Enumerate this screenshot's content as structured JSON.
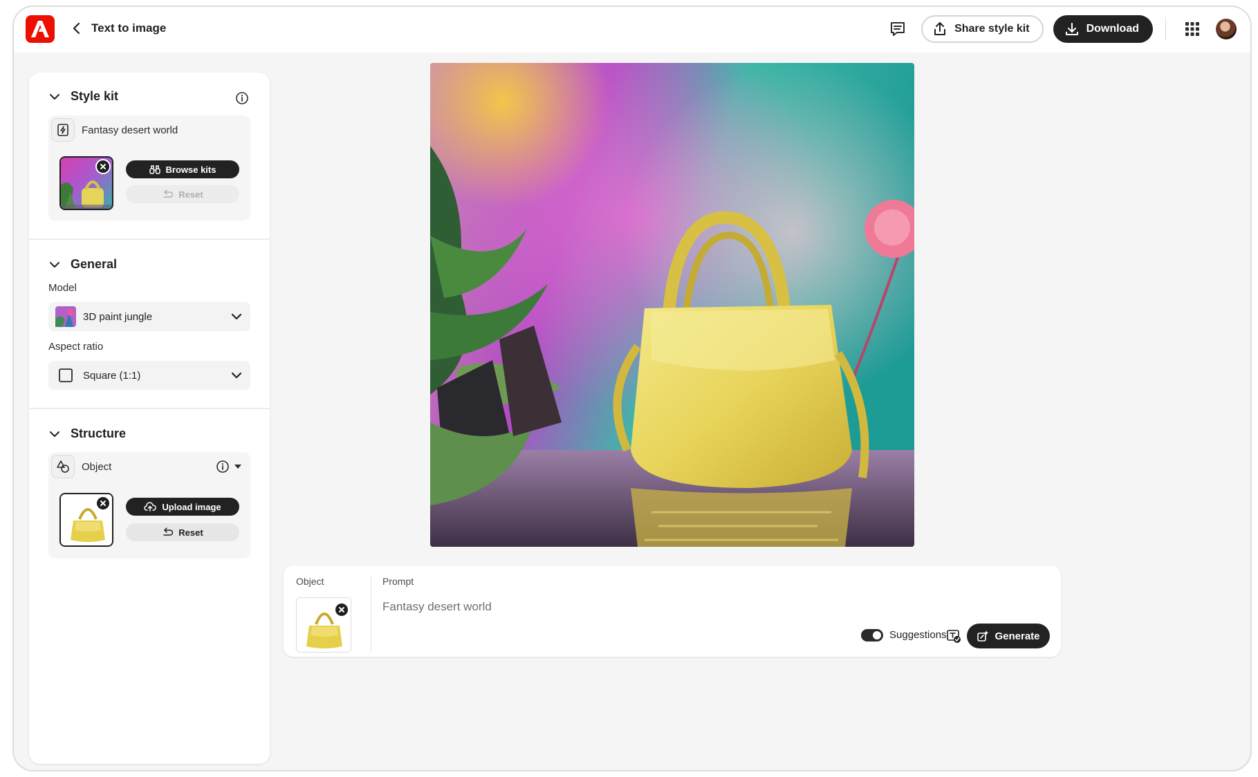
{
  "header": {
    "back_label": "Text to image",
    "share_label": "Share style kit",
    "download_label": "Download",
    "brand_color": "#eb1000"
  },
  "style_kit": {
    "title": "Style kit",
    "kit_name": "Fantasy desert world",
    "browse_label": "Browse kits",
    "reset_label": "Reset"
  },
  "general": {
    "title": "General",
    "model_label": "Model",
    "model_value": "3D paint jungle",
    "aspect_label": "Aspect ratio",
    "aspect_value": "Square (1:1)"
  },
  "structure": {
    "title": "Structure",
    "type_value": "Object",
    "upload_label": "Upload image",
    "reset_label": "Reset"
  },
  "prompt_bar": {
    "object_label": "Object",
    "prompt_label": "Prompt",
    "prompt_text": "Fantasy desert world",
    "suggestions_label": "Suggestions",
    "suggestions_on": true,
    "generate_label": "Generate"
  },
  "icons": [
    "adobe-logo-icon",
    "chevron-left-icon",
    "comment-icon",
    "share-icon",
    "download-icon",
    "app-grid-icon",
    "chevron-down-icon",
    "info-icon",
    "style-kit-icon",
    "binoculars-icon",
    "reset-icon",
    "object-shape-icon",
    "caret-down-icon",
    "upload-cloud-icon",
    "close-icon",
    "suggestions-icon",
    "generate-icon"
  ]
}
